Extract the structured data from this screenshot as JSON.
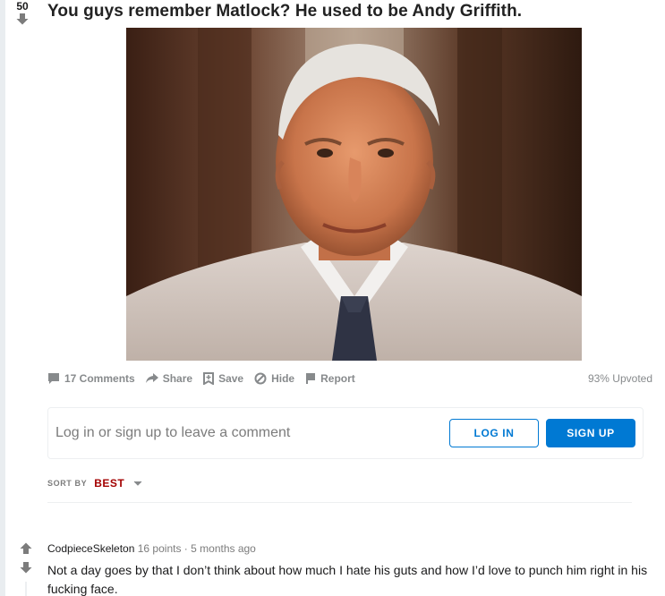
{
  "post": {
    "score": "50",
    "title": "You guys remember Matlock? He used to be Andy Griffith.",
    "upvote_ratio": "93% Upvoted"
  },
  "actions": {
    "comments": "17 Comments",
    "share": "Share",
    "save": "Save",
    "hide": "Hide",
    "report": "Report"
  },
  "comment_box": {
    "prompt": "Log in or sign up to leave a comment",
    "login": "LOG IN",
    "signup": "SIGN UP"
  },
  "sort": {
    "label": "SORT BY",
    "value": "BEST"
  },
  "comments": [
    {
      "author": "CodpieceSkeleton",
      "points": "16 points",
      "separator": "·",
      "age": "5 months ago",
      "body": "Not a day goes by that I don’t think about how much I hate his guts and how I’d love to punch him right in his fucking face."
    }
  ],
  "colors": {
    "accent": "#0079d3",
    "sort_accent": "#a30000",
    "muted": "#878a8c"
  },
  "icons": [
    "upvote-arrow-icon",
    "downvote-arrow-icon",
    "comment-bubble-icon",
    "share-arrow-icon",
    "bookmark-plus-icon",
    "hide-circle-icon",
    "flag-icon",
    "chevron-down-icon"
  ]
}
